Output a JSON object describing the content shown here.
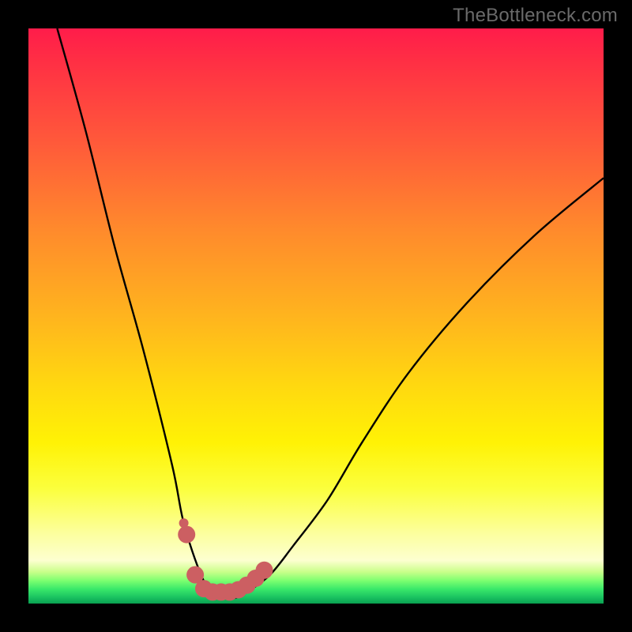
{
  "watermark": "TheBottleneck.com",
  "colors": {
    "background": "#000000",
    "curve": "#000000",
    "marker": "#cc5f62",
    "gradient_stops": [
      "#ff1c4a",
      "#ff3044",
      "#ff5a3a",
      "#ff8a2c",
      "#ffb41e",
      "#ffd810",
      "#fff205",
      "#fbff3d",
      "#fcffa0",
      "#fdffd0",
      "#c9ff8a",
      "#7dff70",
      "#39e86a",
      "#18c060",
      "#0aa050"
    ]
  },
  "chart_data": {
    "type": "line",
    "title": "",
    "xlabel": "",
    "ylabel": "",
    "xlim": [
      0,
      100
    ],
    "ylim": [
      0,
      100
    ],
    "series": [
      {
        "name": "bottleneck-curve",
        "x": [
          5,
          10,
          15,
          20,
          25,
          27,
          30,
          32,
          34,
          36,
          38,
          42,
          46,
          52,
          58,
          66,
          76,
          88,
          100
        ],
        "values": [
          100,
          82,
          62,
          44,
          24,
          14,
          5,
          2,
          1,
          1,
          2,
          5,
          10,
          18,
          28,
          40,
          52,
          64,
          74
        ]
      }
    ],
    "markers": {
      "name": "highlighted-minimum",
      "x": [
        27.5,
        29.0,
        30.5,
        32.0,
        33.5,
        35.0,
        36.5,
        38.0,
        39.5,
        41.0
      ],
      "values": [
        12.0,
        5.0,
        2.6,
        2.0,
        2.0,
        2.0,
        2.4,
        3.2,
        4.4,
        5.8
      ]
    },
    "extra_markers": {
      "name": "isolated-dot",
      "x": [
        27.0
      ],
      "values": [
        14.0
      ]
    }
  }
}
